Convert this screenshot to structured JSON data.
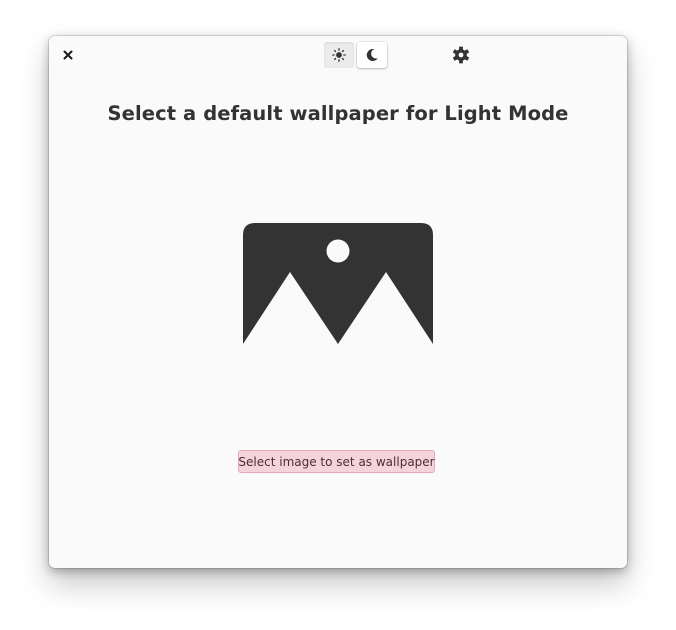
{
  "header": {
    "close_icon": "close-icon",
    "light_mode_icon": "sun-icon",
    "dark_mode_icon": "moon-icon",
    "settings_icon": "gear-icon",
    "active_mode": "light"
  },
  "main": {
    "title": "Select a default wallpaper for Light Mode",
    "placeholder_icon": "image-placeholder-icon",
    "select_button_label": "Select image to set as wallpaper"
  },
  "colors": {
    "window_background": "#fafafa",
    "title_text": "#333333",
    "icon_dark": "#333333",
    "button_background": "#f5d3db",
    "button_border": "#e4a9b7"
  }
}
